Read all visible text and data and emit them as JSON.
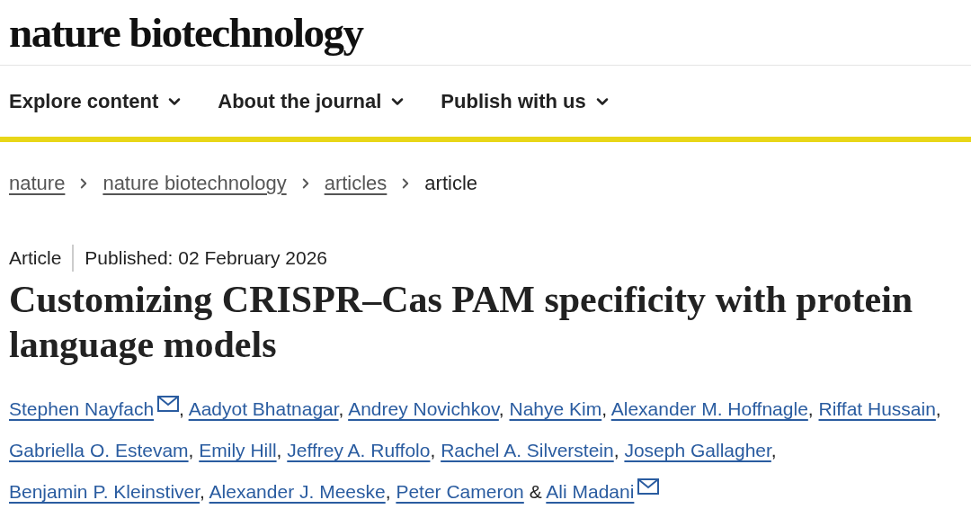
{
  "logo": "nature biotechnology",
  "nav": [
    {
      "label": "Explore content"
    },
    {
      "label": "About the journal"
    },
    {
      "label": "Publish with us"
    }
  ],
  "breadcrumb": [
    {
      "label": "nature",
      "current": false
    },
    {
      "label": "nature biotechnology",
      "current": false
    },
    {
      "label": "articles",
      "current": false
    },
    {
      "label": "article",
      "current": true
    }
  ],
  "article": {
    "type": "Article",
    "published": "Published: 02 February 2026",
    "title": "Customizing CRISPR–Cas PAM specificity with protein language models",
    "authors": [
      {
        "name": "Stephen Nayfach",
        "email": true,
        "sep": ","
      },
      {
        "name": "Aadyot Bhatnagar",
        "email": false,
        "sep": ","
      },
      {
        "name": "Andrey Novichkov",
        "email": false,
        "sep": ","
      },
      {
        "name": "Nahye Kim",
        "email": false,
        "sep": ","
      },
      {
        "name": "Alexander M. Hoffnagle",
        "email": false,
        "sep": ","
      },
      {
        "name": "Riffat Hussain",
        "email": false,
        "sep": ","
      },
      {
        "name": "Gabriella O. Estevam",
        "email": false,
        "sep": ","
      },
      {
        "name": "Emily Hill",
        "email": false,
        "sep": ","
      },
      {
        "name": "Jeffrey A. Ruffolo",
        "email": false,
        "sep": ","
      },
      {
        "name": "Rachel A. Silverstein",
        "email": false,
        "sep": ","
      },
      {
        "name": "Joseph Gallagher",
        "email": false,
        "sep": ","
      },
      {
        "name": "Benjamin P. Kleinstiver",
        "email": false,
        "sep": ","
      },
      {
        "name": "Alexander J. Meeske",
        "email": false,
        "sep": ","
      },
      {
        "name": "Peter Cameron",
        "email": false,
        "sep": "&"
      },
      {
        "name": "Ali Madani",
        "email": true
      }
    ]
  }
}
